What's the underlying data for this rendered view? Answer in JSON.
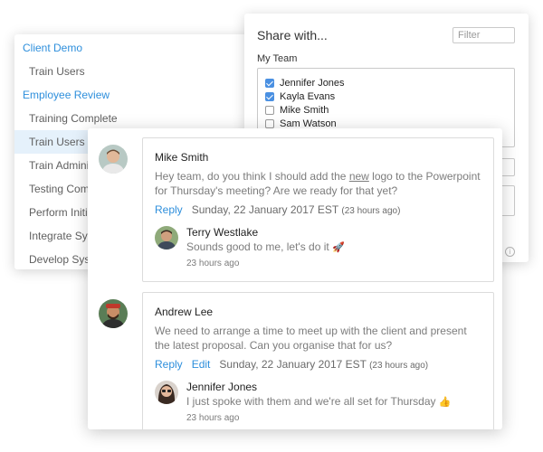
{
  "nav": {
    "items": [
      {
        "label": "Client Demo",
        "kind": "header"
      },
      {
        "label": "Train Users",
        "kind": "item"
      },
      {
        "label": "Employee Review",
        "kind": "header"
      },
      {
        "label": "Training Complete",
        "kind": "item"
      },
      {
        "label": "Train Users",
        "kind": "item",
        "active": true
      },
      {
        "label": "Train Adminis",
        "kind": "item"
      },
      {
        "label": "Testing Comp",
        "kind": "item"
      },
      {
        "label": "Perform Initia",
        "kind": "item"
      },
      {
        "label": "Integrate Syst",
        "kind": "item"
      },
      {
        "label": "Develop Syste",
        "kind": "item"
      }
    ]
  },
  "share": {
    "title": "Share with...",
    "filter_placeholder": "Filter",
    "team_label": "My Team",
    "members": [
      {
        "name": "Jennifer Jones",
        "checked": true
      },
      {
        "name": "Kayla Evans",
        "checked": true
      },
      {
        "name": "Mike Smith",
        "checked": false
      },
      {
        "name": "Sam Watson",
        "checked": false
      }
    ]
  },
  "comments": [
    {
      "author": "Mike Smith",
      "body_before": "Hey team, do you think I should add the ",
      "body_link": "new",
      "body_after": " logo to the Powerpoint for Thursday's meeting? Are we ready for that yet?",
      "reply_label": "Reply",
      "date": "Sunday, 22 January 2017 EST",
      "ago": "(23 hours ago)",
      "reply": {
        "author": "Terry Westlake",
        "body": "Sounds good to me, let's do it",
        "emoji": "🚀",
        "ago": "23 hours ago"
      }
    },
    {
      "author": "Andrew Lee",
      "body": "We need to arrange a time to meet up with the client and present the latest proposal. Can you organise that for us?",
      "reply_label": "Reply",
      "edit_label": "Edit",
      "date": "Sunday, 22 January 2017 EST",
      "ago": "(23 hours ago)",
      "reply": {
        "author": "Jennifer Jones",
        "body": "I just spoke with them and we're all set for Thursday",
        "emoji": "👍",
        "ago": "23 hours ago"
      }
    }
  ],
  "colors": {
    "link": "#2e8fdc",
    "active_row": "#e5f1fb",
    "checkbox_on": "#4a90e2"
  },
  "icons": [
    "check-icon",
    "info-icon",
    "rocket-emoji",
    "thumbs-up-emoji"
  ]
}
